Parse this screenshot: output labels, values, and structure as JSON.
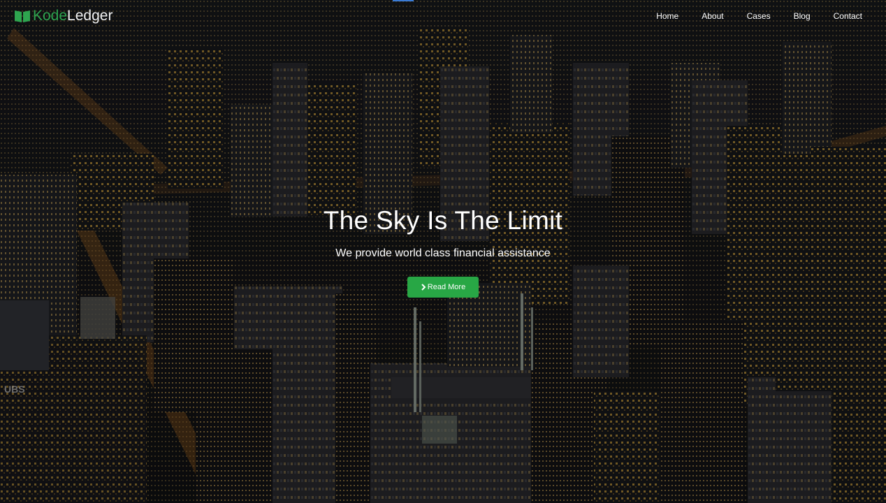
{
  "brand": {
    "name_part1": "Kode",
    "name_part2": "Ledger",
    "icon": "book-icon",
    "accent_color": "#2ea44f"
  },
  "nav": {
    "items": [
      {
        "label": "Home"
      },
      {
        "label": "About"
      },
      {
        "label": "Cases"
      },
      {
        "label": "Blog"
      },
      {
        "label": "Contact"
      }
    ]
  },
  "hero": {
    "title": "The Sky Is The Limit",
    "subtitle": "We provide world class financial assistance",
    "button_label": "Read More",
    "button_icon": "chevron-right-icon",
    "button_color": "#28a745",
    "background": "night-city-skyline-image"
  }
}
